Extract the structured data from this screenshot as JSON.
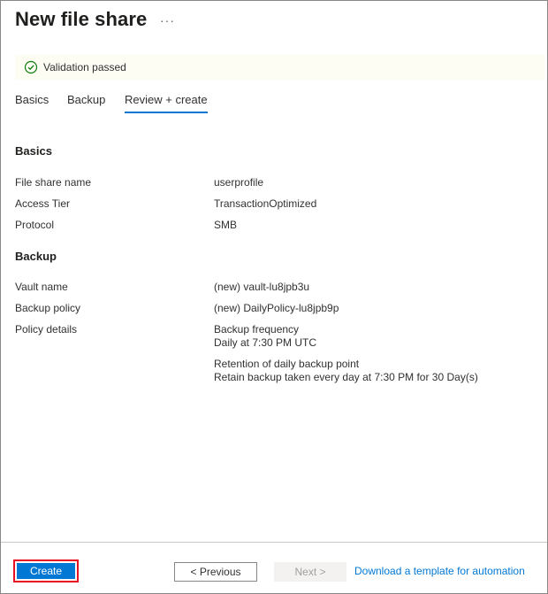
{
  "header": {
    "title": "New file share",
    "more_label": "···"
  },
  "validation": {
    "text": "Validation passed",
    "icon": "check-circle-icon",
    "color": "#107c10"
  },
  "tabs": [
    {
      "label": "Basics"
    },
    {
      "label": "Backup"
    },
    {
      "label": "Review + create",
      "active": true
    }
  ],
  "basics": {
    "heading": "Basics",
    "rows": [
      {
        "label": "File share name",
        "value": "userprofile"
      },
      {
        "label": "Access Tier",
        "value": "TransactionOptimized"
      },
      {
        "label": "Protocol",
        "value": "SMB"
      }
    ]
  },
  "backup": {
    "heading": "Backup",
    "rows": [
      {
        "label": "Vault name",
        "value": "(new) vault-lu8jpb3u"
      },
      {
        "label": "Backup policy",
        "value": "(new) DailyPolicy-lu8jpb9p"
      }
    ],
    "policy_details": {
      "label": "Policy details",
      "frequency_title": "Backup frequency",
      "frequency_value": "Daily at 7:30 PM UTC",
      "retention_title": "Retention of daily backup point",
      "retention_value": "Retain backup taken every day at 7:30 PM for 30 Day(s)"
    }
  },
  "footer": {
    "create_label": "Create",
    "previous_label": "< Previous",
    "next_label": "Next >",
    "download_link": "Download a template for automation"
  },
  "colors": {
    "accent": "#0078d4",
    "highlight_outline": "#e81123"
  }
}
